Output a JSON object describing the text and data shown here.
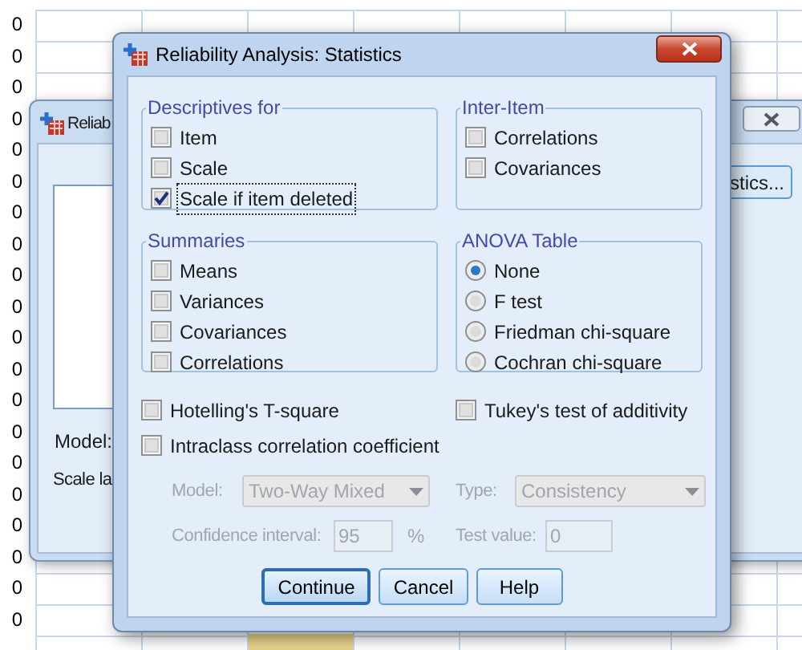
{
  "spreadsheet": {
    "row_labels": [
      "0",
      "0",
      "0",
      "0",
      "0",
      "0",
      "0",
      "0",
      "0",
      "0",
      "0",
      "0",
      "0",
      "0",
      "0",
      "0",
      "0",
      "0",
      "0",
      "0"
    ]
  },
  "back_dialog": {
    "title": "Reliab",
    "button": "stics...",
    "labels": [
      "Model:",
      "Scale la"
    ]
  },
  "dialog": {
    "title": "Reliability Analysis: Statistics",
    "groups": [
      {
        "title": "Descriptives for",
        "kind": "checkbox",
        "items": [
          {
            "label": "Item",
            "checked": false,
            "focused": false
          },
          {
            "label": "Scale",
            "checked": false,
            "focused": false
          },
          {
            "label": "Scale if item deleted",
            "checked": true,
            "focused": true
          }
        ]
      },
      {
        "title": "Inter-Item",
        "kind": "checkbox",
        "items": [
          {
            "label": "Correlations",
            "checked": false,
            "focused": false
          },
          {
            "label": "Covariances",
            "checked": false,
            "focused": false
          }
        ]
      },
      {
        "title": "Summaries",
        "kind": "checkbox",
        "items": [
          {
            "label": "Means",
            "checked": false,
            "focused": false
          },
          {
            "label": "Variances",
            "checked": false,
            "focused": false
          },
          {
            "label": "Covariances",
            "checked": false,
            "focused": false
          },
          {
            "label": "Correlations",
            "checked": false,
            "focused": false
          }
        ]
      },
      {
        "title": "ANOVA Table",
        "kind": "radio",
        "items": [
          {
            "label": "None",
            "selected": true
          },
          {
            "label": "F test",
            "selected": false
          },
          {
            "label": "Friedman chi-square",
            "selected": false
          },
          {
            "label": "Cochran chi-square",
            "selected": false
          }
        ]
      }
    ],
    "options": [
      {
        "label": "Hotelling's T-square",
        "checked": false
      },
      {
        "label": "Tukey's test of additivity",
        "checked": false
      },
      {
        "label": "Intraclass correlation coefficient",
        "checked": false
      }
    ],
    "fields": [
      {
        "label": "Model:",
        "kind": "select",
        "value": "Two-Way Mixed",
        "disabled": true
      },
      {
        "label": "Type:",
        "kind": "select",
        "value": "Consistency",
        "disabled": true
      },
      {
        "label": "Confidence interval:",
        "kind": "input",
        "value": "95",
        "suffix": "%",
        "disabled": true
      },
      {
        "label": "Test value:",
        "kind": "input",
        "value": "0",
        "disabled": true
      }
    ],
    "buttons": [
      {
        "label": "Continue",
        "default": true
      },
      {
        "label": "Cancel",
        "default": false
      },
      {
        "label": "Help",
        "default": false
      }
    ]
  }
}
